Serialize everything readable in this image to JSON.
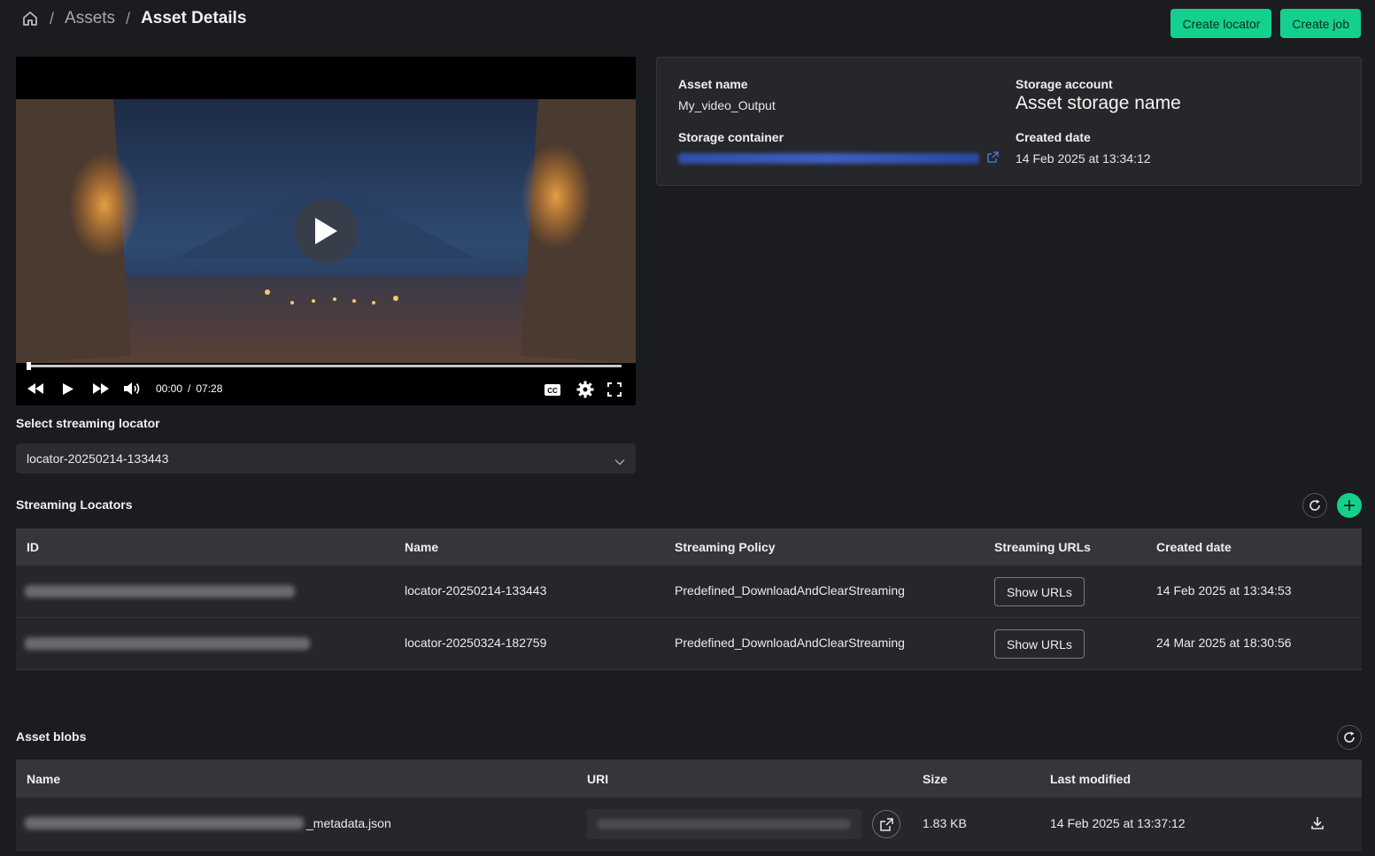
{
  "breadcrumb": {
    "separator": "/",
    "items": [
      "Assets",
      "Asset Details"
    ]
  },
  "header": {
    "create_locator_label": "Create locator",
    "create_job_label": "Create job"
  },
  "player": {
    "current_time": "00:00",
    "time_separator": "/",
    "duration": "07:28",
    "progress": 0.005,
    "cc_label": "CC"
  },
  "asset_info": {
    "asset_name_label": "Asset name",
    "asset_name": "My_video_Output",
    "storage_account_label": "Storage account",
    "storage_account": "Asset storage name",
    "storage_container_label": "Storage container",
    "created_date_label": "Created date",
    "created_date": "14 Feb 2025 at 13:34:12"
  },
  "locator_select": {
    "label": "Select streaming locator",
    "selected": "locator-20250214-133443"
  },
  "streaming_locators": {
    "title": "Streaming Locators",
    "columns": [
      "ID",
      "Name",
      "Streaming Policy",
      "Streaming URLs",
      "Created date"
    ],
    "show_urls_label": "Show URLs",
    "rows": [
      {
        "name": "locator-20250214-133443",
        "policy": "Predefined_DownloadAndClearStreaming",
        "created": "14 Feb 2025 at 13:34:53"
      },
      {
        "name": "locator-20250324-182759",
        "policy": "Predefined_DownloadAndClearStreaming",
        "created": "24 Mar 2025 at 18:30:56"
      }
    ]
  },
  "asset_blobs": {
    "title": "Asset blobs",
    "columns": [
      "Name",
      "URI",
      "Size",
      "Last modified"
    ],
    "rows": [
      {
        "name_suffix": "_metadata.json",
        "size": "1.83 KB",
        "modified": "14 Feb 2025 at 13:37:12"
      }
    ]
  },
  "colors": {
    "accent": "#14d08f",
    "background": "#1b1c1f",
    "card": "#26272b",
    "table_header": "#35363b"
  }
}
